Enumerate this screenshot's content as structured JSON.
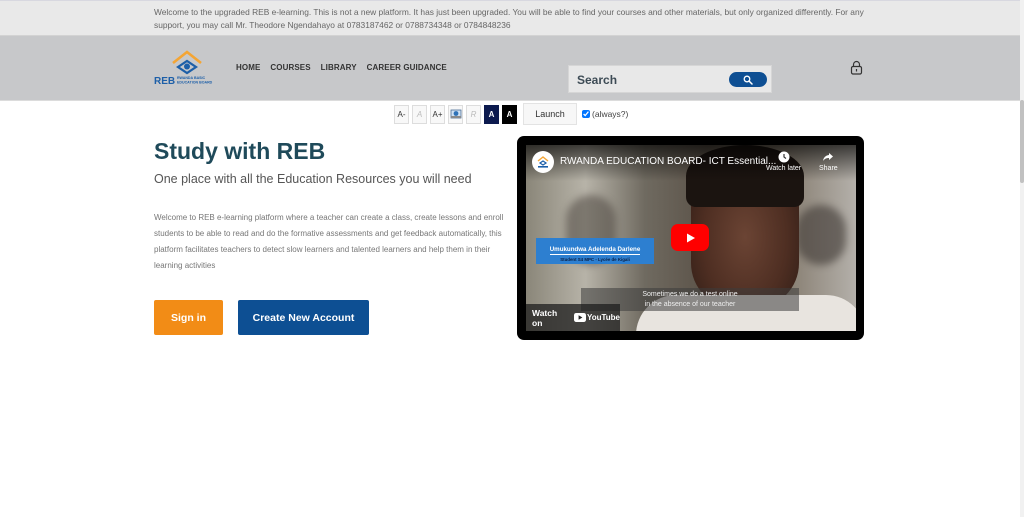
{
  "notice": {
    "text": "Welcome to the upgraded REB e-learning. This is not a new platform. It has just been upgraded. You will be able to find your courses and other materials, but only organized differently. For any support, you may call Mr. Theodore Ngendahayo at 0783187462 or 0788734348 or 0784848236"
  },
  "header": {
    "logo_text": "REB",
    "logo_subtext_line1": "RWANDA BASIC",
    "logo_subtext_line2": "EDUCATION BOARD",
    "nav": [
      {
        "label": "HOME"
      },
      {
        "label": "COURSES"
      },
      {
        "label": "LIBRARY"
      },
      {
        "label": "CAREER GUIDANCE"
      }
    ],
    "search": {
      "placeholder": "Search",
      "value": "",
      "button_icon": "search-icon"
    },
    "login_icon": "lock-icon"
  },
  "accessibility": {
    "buttons": [
      {
        "label": "A-",
        "action": "decrease-font"
      },
      {
        "label": "A",
        "action": "reset-font"
      },
      {
        "label": "A+",
        "action": "increase-font"
      },
      {
        "label": "",
        "action": "picture-icon"
      },
      {
        "label": "R",
        "action": "reset-colors"
      },
      {
        "label": "A",
        "action": "navy-contrast"
      },
      {
        "label": "A",
        "action": "black-contrast"
      }
    ],
    "launch_label": "Launch",
    "always_label": "(always?)",
    "always_checked": true
  },
  "hero": {
    "title": "Study with REB",
    "subtitle": "One place with all the Education Resources you will need",
    "body": "Welcome to REB e-learning  platform where a teacher can create a class, create lessons and enroll students to be able to read and do the formative assessments and get feedback automatically,  this platform facilitates teachers to detect slow learners and talented learners and help them in their learning activities",
    "signin_label": "Sign in",
    "create_label": "Create New Account"
  },
  "video": {
    "title": "RWANDA EDUCATION BOARD- ICT Essential...",
    "watch_later_label": "Watch later",
    "share_label": "Share",
    "caption_name": "Umukundwa Adelenda Darlene",
    "caption_role": "Student S4 MPC - Lycée de Kigali",
    "subtitle_line1": "Sometimes we do a test online",
    "subtitle_line2": "in the absence of our teacher",
    "watch_on_label": "Watch on",
    "youtube_label": "YouTube"
  },
  "colors": {
    "brand_orange": "#f28c16",
    "brand_blue": "#0d4f93",
    "title_teal": "#1f4a5a",
    "header_gray": "#c7c8ca",
    "youtube_red": "#ff0000"
  }
}
